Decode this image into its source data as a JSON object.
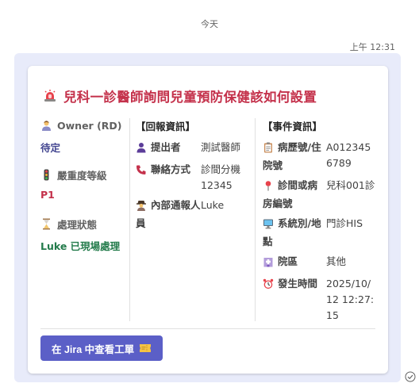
{
  "chat": {
    "day_divider": "今天",
    "timestamp": "上午 12:31"
  },
  "card": {
    "title_icon": "siren-icon",
    "title": "兒科一診醫師詢問兒童預防保健該如何設置",
    "status_column": {
      "owner_label": "Owner (RD)",
      "owner_value": "待定",
      "severity_label": "嚴重度等級",
      "severity_value": "P1",
      "state_label": "處理狀態",
      "state_value": "Luke 已現場處理"
    },
    "report_section": {
      "heading": "【回報資訊】",
      "rows": [
        {
          "icon": "person-icon",
          "key": "提出者",
          "value": "測試醫師"
        },
        {
          "icon": "phone-icon",
          "key": "聯絡方式",
          "value": "診間分機12345"
        },
        {
          "icon": "detective-icon",
          "key": "內部通報人員",
          "value": "Luke"
        }
      ]
    },
    "event_section": {
      "heading": "【事件資訊】",
      "rows": [
        {
          "icon": "clipboard-icon",
          "key": "病歷號/住院號",
          "value": "A0123456789"
        },
        {
          "icon": "pushpin-icon",
          "key": "診間或病房編號",
          "value": "兒科001診"
        },
        {
          "icon": "computer-icon",
          "key": "系統別/地點",
          "value": "門診HIS"
        },
        {
          "icon": "hospital-icon",
          "key": "院區",
          "value": "其他"
        },
        {
          "icon": "alarm-clock-icon",
          "key": "發生時間",
          "value": "2025/10/12 12:27:15"
        }
      ]
    },
    "action_button": {
      "label": "在 Jira 中查看工單",
      "icon": "ticket-icon"
    }
  },
  "colors": {
    "title": "#c4314b",
    "owner_value": "#444791",
    "severity_value": "#c4314b",
    "state_value": "#237b4b",
    "button_bg": "#5b5fc7",
    "bubble_bg": "#e8ebfa"
  }
}
